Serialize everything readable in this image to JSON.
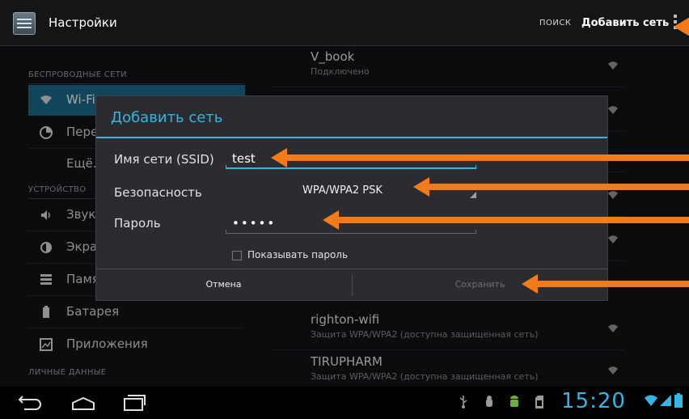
{
  "actionbar": {
    "title": "Настройки",
    "search_label": "ПОИСК",
    "add_network_label": "Добавить сеть"
  },
  "left": {
    "section_wireless": "БЕСПРОВОДНЫЕ СЕТИ",
    "section_device": "УСТРОЙСТВО",
    "section_personal": "ЛИЧНЫЕ ДАННЫЕ",
    "items": [
      {
        "label": "Wi-Fi",
        "icon": "wifi-icon"
      },
      {
        "label": "Передача данных",
        "icon": "data-usage-icon"
      },
      {
        "label": "Ещё...",
        "icon": ""
      },
      {
        "label": "Звук",
        "icon": "sound-icon"
      },
      {
        "label": "Экран",
        "icon": "display-icon"
      },
      {
        "label": "Память",
        "icon": "storage-icon"
      },
      {
        "label": "Батарея",
        "icon": "battery-icon"
      },
      {
        "label": "Приложения",
        "icon": "apps-icon"
      }
    ]
  },
  "wifi_list": [
    {
      "name": "V_book",
      "status": "Подключено"
    },
    {
      "name": "righton-wifi",
      "status": "Защита WPA/WPA2 (доступна защищенная сеть)"
    },
    {
      "name": "TIRUPHARM",
      "status": "Защита WPA/WPA2 (доступна защищенная сеть)"
    }
  ],
  "dialog": {
    "title": "Добавить сеть",
    "ssid_label": "Имя сети (SSID)",
    "ssid_value": "test",
    "security_label": "Безопасность",
    "security_value": "WPA/WPA2 PSK",
    "password_label": "Пароль",
    "password_value": "•••••",
    "show_password_label": "Показывать пароль",
    "cancel_label": "Отмена",
    "save_label": "Сохранить"
  },
  "statusbar": {
    "clock": "15:20"
  },
  "colors": {
    "accent": "#33b5e5",
    "annotation": "#f47a1a"
  }
}
